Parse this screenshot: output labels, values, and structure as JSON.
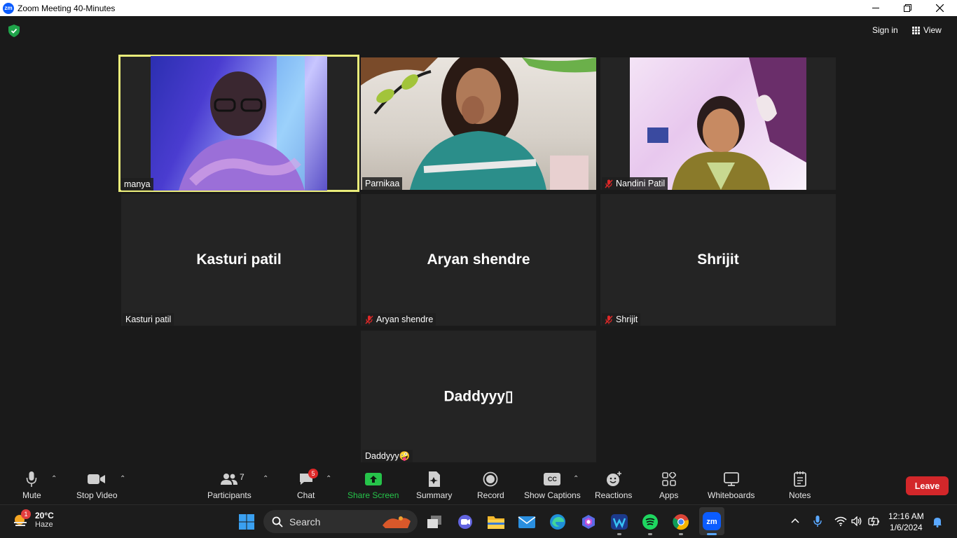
{
  "window": {
    "title": "Zoom Meeting 40-Minutes",
    "app_icon_text": "zm",
    "controls": [
      "minimize-icon",
      "maximize-icon",
      "close-icon"
    ]
  },
  "topbar": {
    "signin_label": "Sign in",
    "view_label": "View"
  },
  "participants_tiles": [
    {
      "name": "manya",
      "display": "video",
      "muted": false,
      "active_speaker": true
    },
    {
      "name": "Parnikaa",
      "display": "video",
      "muted": false,
      "active_speaker": false
    },
    {
      "name": "Nandini Patil",
      "display": "video",
      "muted": true,
      "active_speaker": false
    },
    {
      "name": "Kasturi patil",
      "display": "name",
      "muted": false,
      "active_speaker": false
    },
    {
      "name": "Aryan shendre",
      "display": "name",
      "muted": true,
      "active_speaker": false
    },
    {
      "name": "Shrijit",
      "display": "name",
      "muted": true,
      "active_speaker": false
    },
    {
      "name": "Daddyyy🤪",
      "big_name": "Daddyyy▯",
      "display": "name",
      "muted": false,
      "active_speaker": false
    }
  ],
  "toolbar": {
    "mute": "Mute",
    "stop_video": "Stop Video",
    "participants": "Participants",
    "participants_count": "7",
    "chat": "Chat",
    "chat_badge": "5",
    "share_screen": "Share Screen",
    "summary": "Summary",
    "record": "Record",
    "show_captions": "Show Captions",
    "captions_icon_text": "CC",
    "reactions": "Reactions",
    "apps": "Apps",
    "whiteboards": "Whiteboards",
    "notes": "Notes",
    "leave": "Leave"
  },
  "taskbar": {
    "weather_badge": "1",
    "temperature": "20°C",
    "condition": "Haze",
    "search_label": "Search",
    "time": "12:16 AM",
    "date": "1/6/2024"
  },
  "colors": {
    "active_speaker_border": "#e9ec7a",
    "leave_red": "#d3272a",
    "share_green": "#26c44a",
    "tile_bg": "#242424"
  }
}
